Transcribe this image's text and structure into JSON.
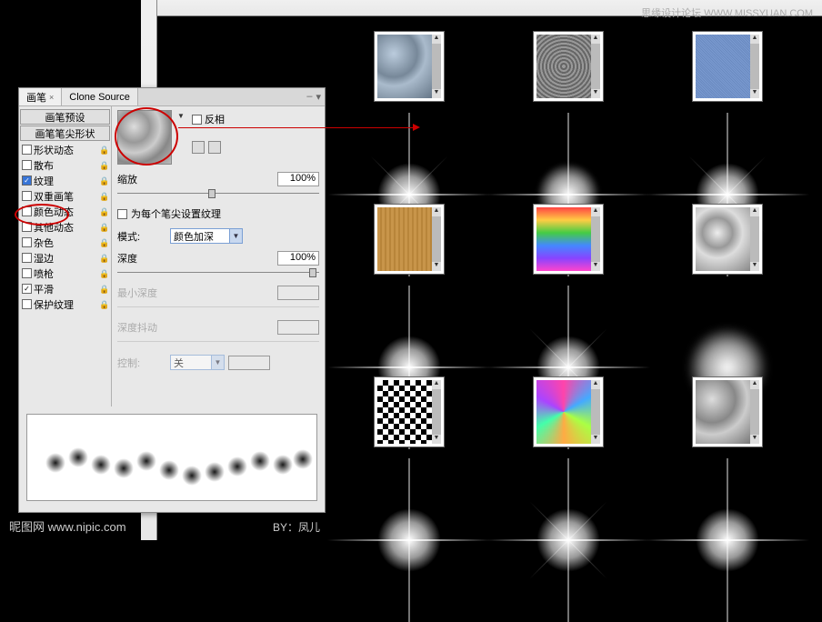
{
  "watermark": {
    "top_right": "思缘设计论坛  WWW.MISSYUAN.COM",
    "bottom_left": "昵图网 www.nipic.com",
    "by": "BY：凤儿"
  },
  "panel": {
    "tabs": [
      {
        "label": "画笔",
        "active": true
      },
      {
        "label": "Clone Source",
        "active": false
      }
    ]
  },
  "options": {
    "preset": "画笔预设",
    "tip_shape": "画笔笔尖形状",
    "items": [
      {
        "label": "形状动态",
        "checked": false
      },
      {
        "label": "散布",
        "checked": false
      },
      {
        "label": "纹理",
        "checked": true
      },
      {
        "label": "双重画笔",
        "checked": false
      },
      {
        "label": "颜色动态",
        "checked": false
      },
      {
        "label": "其他动态",
        "checked": false
      },
      {
        "label": "杂色",
        "checked": false
      },
      {
        "label": "湿边",
        "checked": false
      },
      {
        "label": "喷枪",
        "checked": false
      },
      {
        "label": "平滑",
        "checked": true
      },
      {
        "label": "保护纹理",
        "checked": false
      }
    ]
  },
  "settings": {
    "invert": {
      "label": "反相",
      "checked": false
    },
    "scale": {
      "label": "缩放",
      "value": "100%"
    },
    "each_tip": {
      "label": "为每个笔尖设置纹理",
      "checked": false
    },
    "mode": {
      "label": "模式:",
      "value": "颜色加深"
    },
    "depth": {
      "label": "深度",
      "value": "100%"
    },
    "min_depth": {
      "label": "最小深度",
      "value": ""
    },
    "depth_jitter": {
      "label": "深度抖动",
      "value": ""
    },
    "control": {
      "label": "控制:",
      "value": "关"
    }
  },
  "textures": [
    {
      "name": "blue-spheres"
    },
    {
      "name": "gravel"
    },
    {
      "name": "denim"
    },
    {
      "name": "wood"
    },
    {
      "name": "rainbow-fractal"
    },
    {
      "name": "metal-foil"
    },
    {
      "name": "checker"
    },
    {
      "name": "oil-slick"
    },
    {
      "name": "clouds"
    }
  ]
}
